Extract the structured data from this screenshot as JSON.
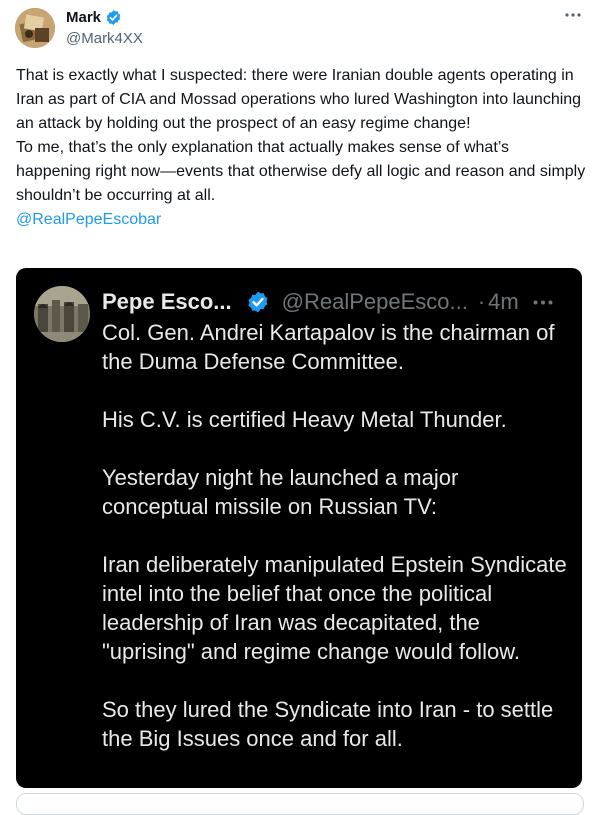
{
  "author": {
    "name": "Mark",
    "handle": "@Mark4XX",
    "verified": true
  },
  "menu": {
    "icon": "more-horizontal-icon"
  },
  "tweet": {
    "paragraphs": [
      "That is exactly what I suspected: there were Iranian double agents operating in Iran as part of CIA and Mossad operations who lured Washington into launching an attack by holding out the prospect of an easy regime change!",
      "To me, that’s the only explanation that actually makes sense of what’s happening right now—events that otherwise defy all logic and reason and simply shouldn’t be occurring at all."
    ],
    "mention": "@RealPepeEscobar"
  },
  "quoted": {
    "name": "Pepe Esco...",
    "handle": "@RealPepeEsco...",
    "separator": "·",
    "time": "4m",
    "verified": true,
    "paragraphs": [
      "Col. Gen. Andrei Kartapalov is the chairman of the Duma Defense Committee.",
      "His C.V. is certified Heavy Metal Thunder.",
      "Yesterday night he launched a major conceptual missile on Russian TV:",
      "Iran deliberately manipulated Epstein Syndicate intel into the belief that once the political leadership of Iran was decapitated, the \"uprising\" and regime change would follow.",
      "So they lured the Syndicate into Iran - to settle the Big Issues once and for all."
    ]
  },
  "colors": {
    "verified_blue": "#1d9bf0",
    "link_blue": "#1d9bf0",
    "card_bg": "#000000"
  }
}
